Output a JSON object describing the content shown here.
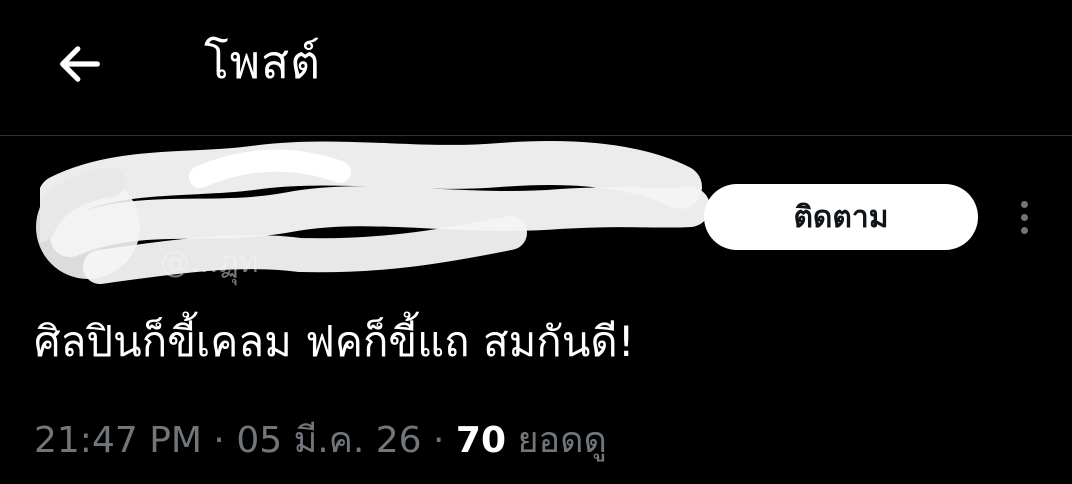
{
  "header": {
    "back_icon": "arrow-left-icon",
    "title": "โพสต์"
  },
  "post": {
    "author": {
      "name": "",
      "handle": "@...ฏุท"
    },
    "follow_label": "ติดตาม",
    "more_icon": "more-vertical-icon",
    "text": "ศิลปินก็ขี้เคลม ฟคก็ขี้แถ สมกันดี!",
    "meta": {
      "time": "21:47 PM",
      "separator": "·",
      "date": "05 มี.ค. 26",
      "views_count": "70",
      "views_label": "ยอดดู"
    }
  },
  "colors": {
    "background": "#000000",
    "text_primary": "#ffffff",
    "text_secondary": "#71767b",
    "divider": "#2f3336",
    "follow_bg": "#ffffff",
    "follow_text": "#0f1419"
  }
}
